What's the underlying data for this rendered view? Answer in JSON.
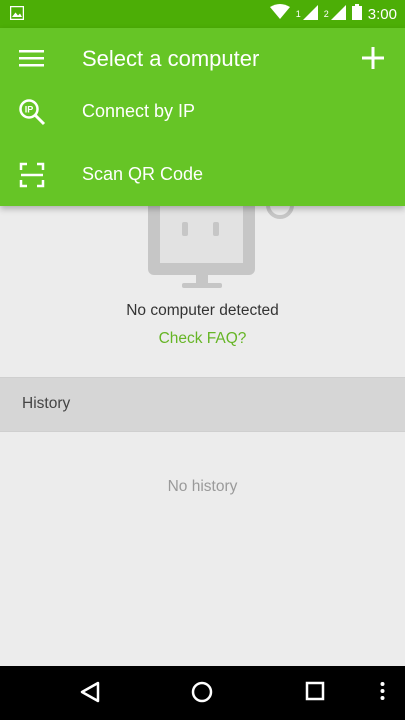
{
  "statusbar": {
    "sim1": "1",
    "sim2": "2",
    "time": "3:00",
    "icons": [
      "image-icon",
      "wifi-icon",
      "signal-icon",
      "battery-icon"
    ]
  },
  "appbar": {
    "title": "Select a computer",
    "menu_icon": "hamburger-icon",
    "add_icon": "plus-icon",
    "items": [
      {
        "label": "Connect by IP",
        "icon": "ip-search-icon"
      },
      {
        "label": "Scan QR Code",
        "icon": "qr-scan-icon"
      }
    ]
  },
  "main": {
    "empty_text": "No computer detected",
    "faq_link": "Check FAQ?",
    "history_header": "History",
    "history_empty": "No history"
  },
  "navbar": {
    "buttons": [
      "back-icon",
      "home-icon",
      "recents-icon",
      "more-icon"
    ]
  },
  "colors": {
    "accent": "#66c526",
    "statusbar": "#4cae06",
    "link": "#66b526"
  }
}
